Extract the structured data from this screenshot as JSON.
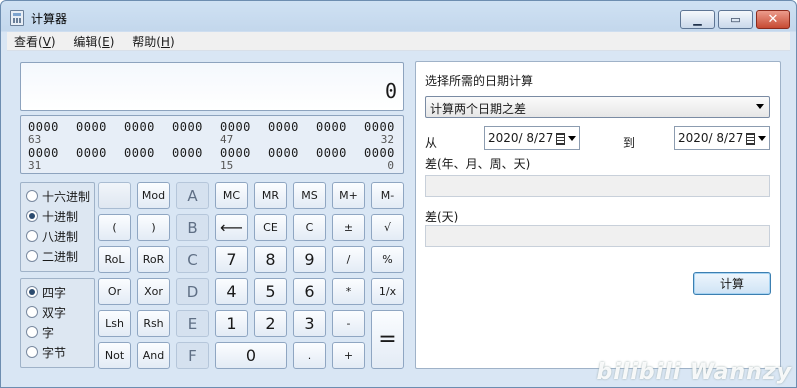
{
  "window": {
    "title": "计算器"
  },
  "menu": [
    {
      "label": "查看(",
      "key": "V",
      "end": ")"
    },
    {
      "label": "编辑(",
      "key": "E",
      "end": ")"
    },
    {
      "label": "帮助(",
      "key": "H",
      "end": ")"
    }
  ],
  "display": {
    "value": "0"
  },
  "bits": {
    "row1": [
      "0000",
      "0000",
      "0000",
      "0000",
      "0000",
      "0000",
      "0000",
      "0000"
    ],
    "row1_labels": {
      "left": "63",
      "mid": "47",
      "right": "32"
    },
    "row2": [
      "0000",
      "0000",
      "0000",
      "0000",
      "0000",
      "0000",
      "0000",
      "0000"
    ],
    "row2_labels": {
      "left": "31",
      "mid": "15",
      "right": "0"
    }
  },
  "base_radios": [
    {
      "label": "十六进制",
      "checked": false
    },
    {
      "label": "十进制",
      "checked": true
    },
    {
      "label": "八进制",
      "checked": false
    },
    {
      "label": "二进制",
      "checked": false
    }
  ],
  "word_radios": [
    {
      "label": "四字",
      "checked": true
    },
    {
      "label": "双字",
      "checked": false
    },
    {
      "label": "字",
      "checked": false
    },
    {
      "label": "字节",
      "checked": false
    }
  ],
  "keys": {
    "blank": "",
    "mod": "Mod",
    "a": "A",
    "mc": "MC",
    "mr": "MR",
    "ms": "MS",
    "mplus": "M+",
    "mminus": "M-",
    "lparen": "(",
    "rparen": ")",
    "b": "B",
    "back": "⟵",
    "ce": "CE",
    "c": "C",
    "pm": "±",
    "sqrt": "√",
    "rol": "RoL",
    "ror": "RoR",
    "hc": "C",
    "n7": "7",
    "n8": "8",
    "n9": "9",
    "div": "/",
    "pct": "%",
    "or": "Or",
    "xor": "Xor",
    "d": "D",
    "n4": "4",
    "n5": "5",
    "n6": "6",
    "mul": "*",
    "recip": "1/x",
    "lsh": "Lsh",
    "rsh": "Rsh",
    "e": "E",
    "n1": "1",
    "n2": "2",
    "n3": "3",
    "sub": "-",
    "eq": "=",
    "not": "Not",
    "and": "And",
    "f": "F",
    "n0": "0",
    "dot": ".",
    "add": "+"
  },
  "date_calc": {
    "prompt": "选择所需的日期计算",
    "mode": "计算两个日期之差",
    "from_label": "从",
    "from_date": "2020/  8/27",
    "to_label": "到",
    "to_date": "2020/  8/27",
    "diff_ymwd_label": "差(年、月、周、天)",
    "diff_ymwd_value": "",
    "diff_days_label": "差(天)",
    "diff_days_value": "",
    "calc_button": "计算"
  },
  "watermark": "bilibili Wannzy"
}
